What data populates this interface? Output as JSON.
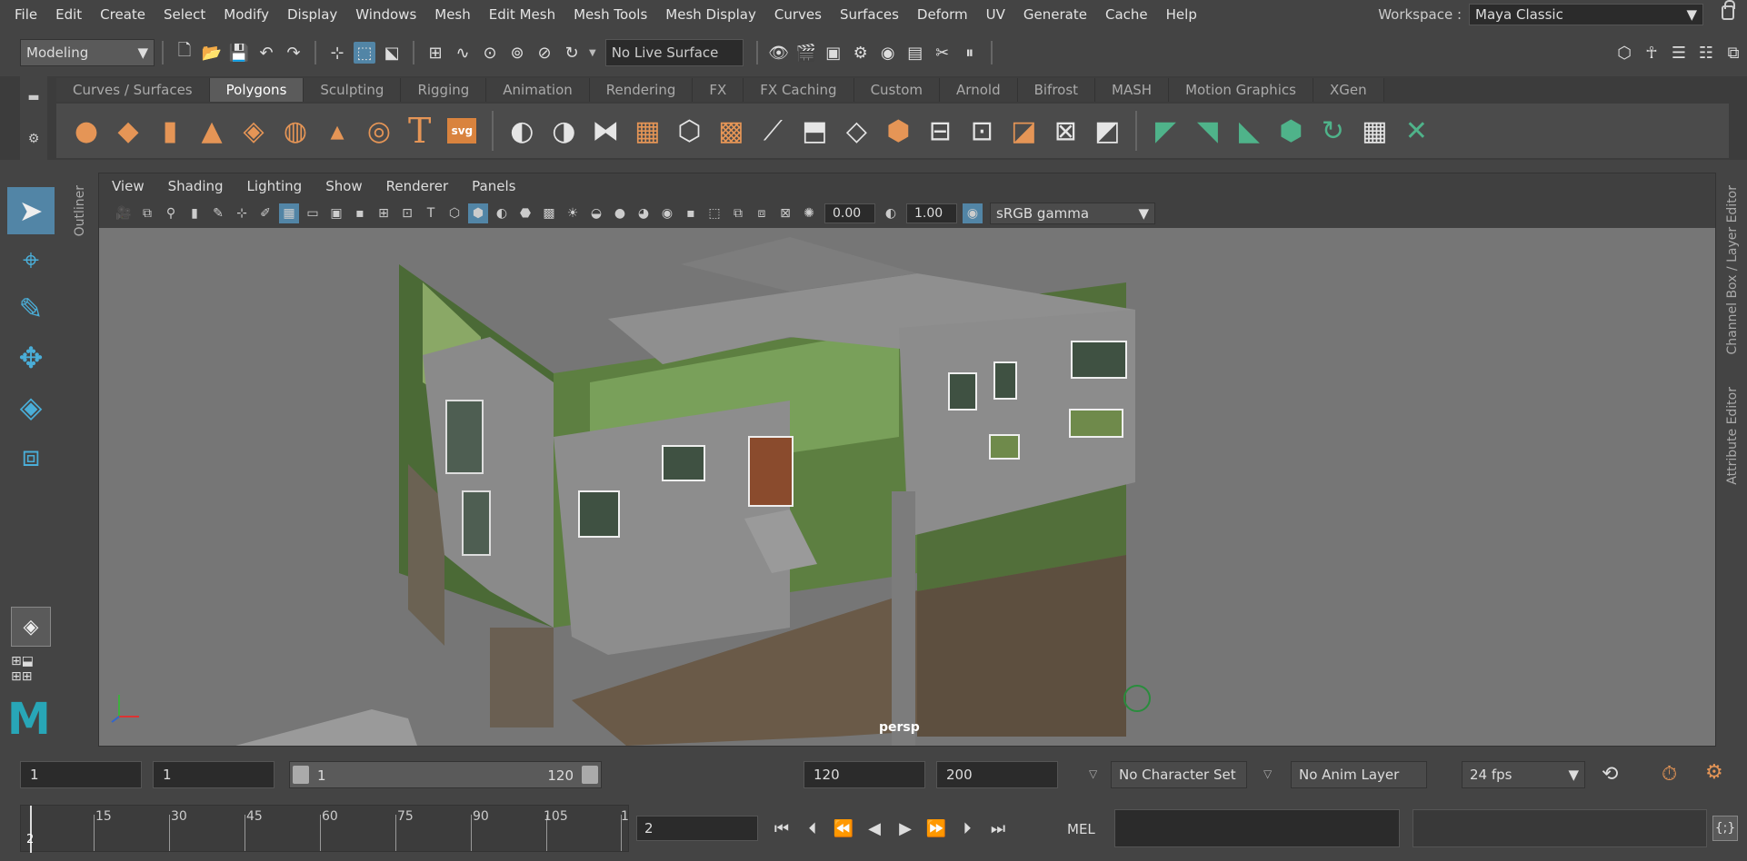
{
  "menu": [
    "File",
    "Edit",
    "Create",
    "Select",
    "Modify",
    "Display",
    "Windows",
    "Mesh",
    "Edit Mesh",
    "Mesh Tools",
    "Mesh Display",
    "Curves",
    "Surfaces",
    "Deform",
    "UV",
    "Generate",
    "Cache",
    "Help"
  ],
  "workspace": {
    "label": "Workspace :",
    "value": "Maya Classic"
  },
  "statusline": {
    "mode": "Modeling",
    "live_surface": "No Live Surface"
  },
  "shelf": {
    "tabs": [
      "Curves / Surfaces",
      "Polygons",
      "Sculpting",
      "Rigging",
      "Animation",
      "Rendering",
      "FX",
      "FX Caching",
      "Custom",
      "Arnold",
      "Bifrost",
      "MASH",
      "Motion Graphics",
      "XGen"
    ],
    "active_tab": "Polygons",
    "text_tool": "T",
    "svg_tool": "svg"
  },
  "panel": {
    "menus": [
      "View",
      "Shading",
      "Lighting",
      "Show",
      "Renderer",
      "Panels"
    ],
    "exposure": "0.00",
    "gamma": "1.00",
    "color_space": "sRGB gamma",
    "camera_label": "persp"
  },
  "side_panels": {
    "outliner": "Outliner",
    "channel_box": "Channel Box / Layer Editor",
    "attribute_editor": "Attribute Editor"
  },
  "range": {
    "start_time": "1",
    "playback_start": "1",
    "slider_start": "1",
    "slider_end": "120",
    "playback_end": "120",
    "end_time": "200",
    "character_set": "No Character Set",
    "anim_layer": "No Anim Layer",
    "fps": "24 fps"
  },
  "timeline": {
    "ticks": [
      "15",
      "30",
      "45",
      "60",
      "75",
      "90",
      "105",
      "1"
    ],
    "current_label": "2",
    "current_frame": "2"
  },
  "command_line": {
    "language": "MEL"
  },
  "colors": {
    "accent": "#5285a6",
    "shelf_icon": "#e59556",
    "shelf_green": "#4fb38a",
    "maya_logo": "#28a6b7"
  }
}
